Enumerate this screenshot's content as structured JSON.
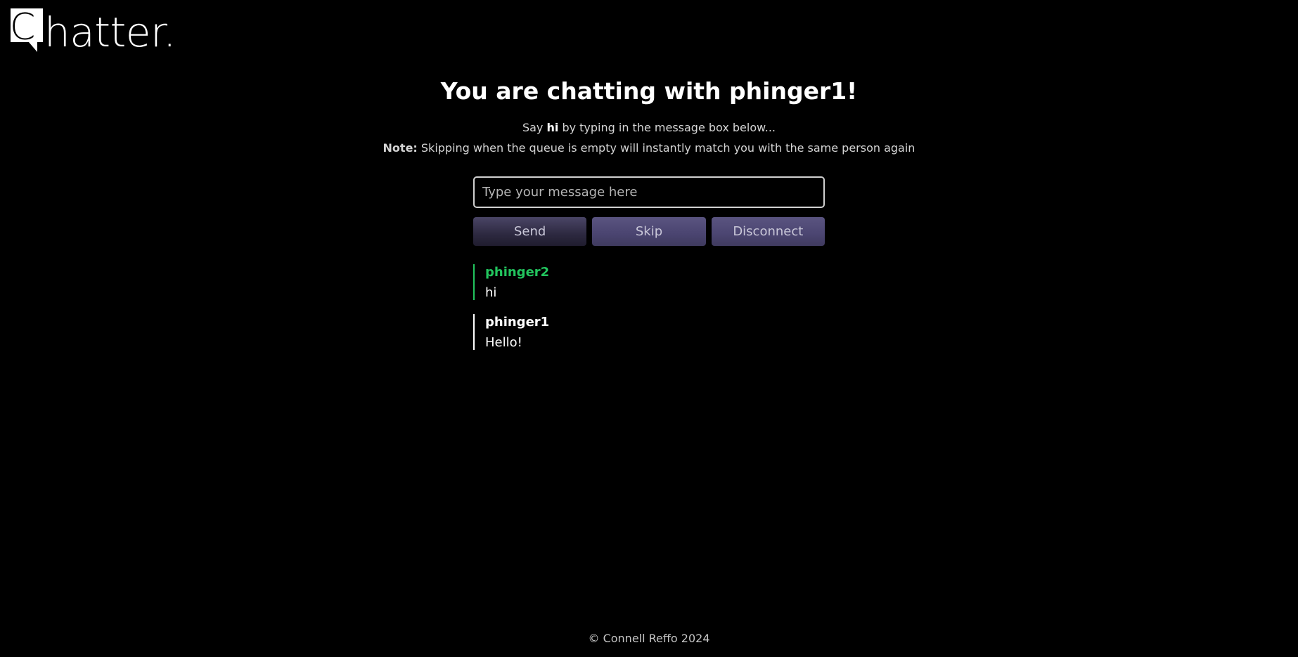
{
  "app": {
    "logo_text": "hatter.",
    "logo_letter": "C"
  },
  "header": {
    "title": "You are chatting with phinger1!"
  },
  "hint": {
    "prefix": "Say ",
    "emphasis": "hi",
    "suffix": " by typing in the message box below..."
  },
  "note": {
    "label": "Note:",
    "text": " Skipping when the queue is empty will instantly match you with the same person again"
  },
  "composer": {
    "placeholder": "Type your message here",
    "value": ""
  },
  "actions": {
    "send_label": "Send",
    "skip_label": "Skip",
    "disconnect_label": "Disconnect"
  },
  "messages": [
    {
      "author": "phinger2",
      "text": "hi"
    },
    {
      "author": "phinger1",
      "text": "Hello!"
    }
  ],
  "colors": {
    "partner": "#22c55e",
    "self": "#ffffff",
    "background": "#000000"
  },
  "footer": {
    "copyright": "© Connell Reffo 2024"
  }
}
